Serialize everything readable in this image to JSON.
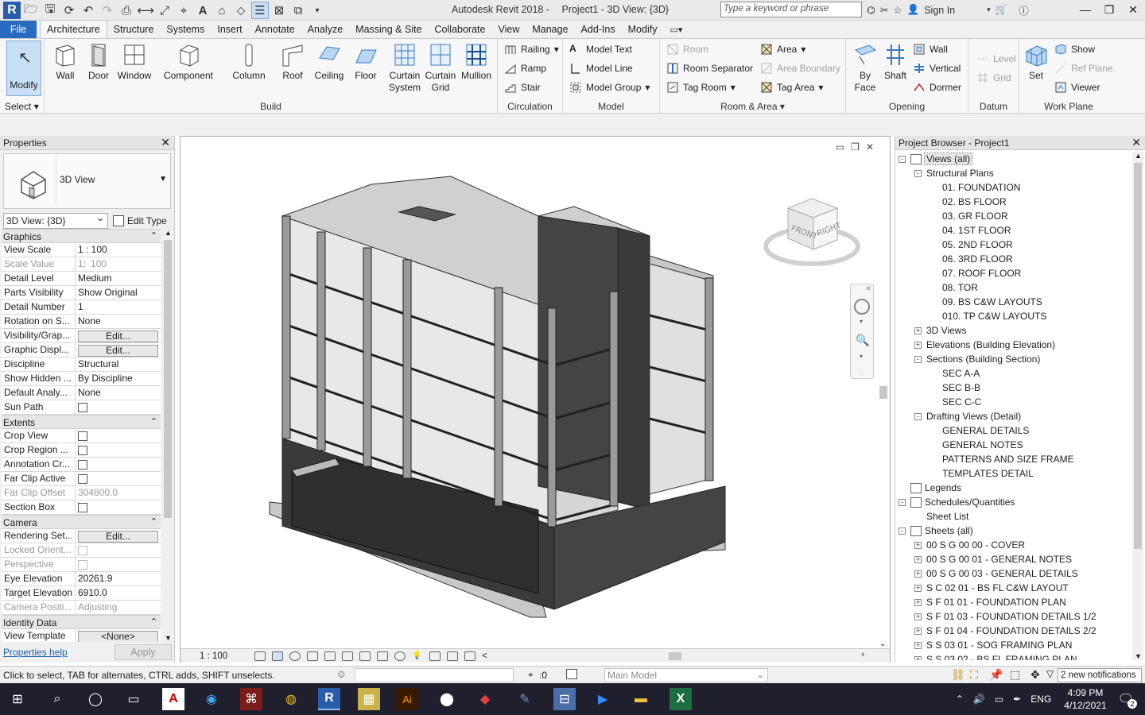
{
  "titlebar": {
    "app_title": "Autodesk Revit 2018 -",
    "doc_title": "Project1 - 3D View: {3D}",
    "search_placeholder": "Type a keyword or phrase",
    "sign_in": "Sign In"
  },
  "tabs": [
    "File",
    "Architecture",
    "Structure",
    "Systems",
    "Insert",
    "Annotate",
    "Analyze",
    "Massing & Site",
    "Collaborate",
    "View",
    "Manage",
    "Add-Ins",
    "Modify"
  ],
  "ribbon": {
    "select": {
      "modify": "Modify",
      "title": "Select"
    },
    "build": {
      "title": "Build",
      "wall": "Wall",
      "door": "Door",
      "window": "Window",
      "component": "Component",
      "column": "Column",
      "roof": "Roof",
      "ceiling": "Ceiling",
      "floor": "Floor",
      "curtain_system_1": "Curtain",
      "curtain_system_2": "System",
      "curtain_grid_1": "Curtain",
      "curtain_grid_2": "Grid",
      "mullion": "Mullion"
    },
    "circulation": {
      "title": "Circulation",
      "railing": "Railing",
      "ramp": "Ramp",
      "stair": "Stair"
    },
    "model": {
      "title": "Model",
      "model_text": "Model  Text",
      "model_line": "Model  Line",
      "model_group": "Model  Group"
    },
    "room_area": {
      "title": "Room & Area",
      "room": "Room",
      "room_separator": "Room  Separator",
      "tag_room": "Tag  Room",
      "area": "Area",
      "area_boundary": "Area  Boundary",
      "tag_area": "Tag  Area"
    },
    "opening": {
      "title": "Opening",
      "by_face_1": "By",
      "by_face_2": "Face",
      "shaft": "Shaft",
      "wall": "Wall",
      "vertical": "Vertical",
      "dormer": "Dormer"
    },
    "datum": {
      "title": "Datum",
      "level": "Level",
      "grid": "Grid"
    },
    "work_plane": {
      "title": "Work Plane",
      "set": "Set",
      "show": "Show",
      "ref_plane": "Ref  Plane",
      "viewer": "Viewer"
    }
  },
  "properties": {
    "title": "Properties",
    "type_name": "3D View",
    "view_selector": "3D View: {3D}",
    "edit_type": "Edit Type",
    "groups": [
      {
        "name": "Graphics",
        "rows": [
          {
            "label": "View Scale",
            "value": "1 : 100"
          },
          {
            "label": "Scale Value",
            "value": "100",
            "prefix": "1:",
            "disabled": true
          },
          {
            "label": "Detail Level",
            "value": "Medium"
          },
          {
            "label": "Parts Visibility",
            "value": "Show Original"
          },
          {
            "label": "Detail Number",
            "value": "1"
          },
          {
            "label": "Rotation on S...",
            "value": "None"
          },
          {
            "label": "Visibility/Grap...",
            "value": "Edit...",
            "button": true
          },
          {
            "label": "Graphic Displ...",
            "value": "Edit...",
            "button": true
          },
          {
            "label": "Discipline",
            "value": "Structural"
          },
          {
            "label": "Show Hidden ...",
            "value": "By Discipline"
          },
          {
            "label": "Default Analy...",
            "value": "None"
          },
          {
            "label": "Sun Path",
            "value": "",
            "checkbox": true
          }
        ]
      },
      {
        "name": "Extents",
        "rows": [
          {
            "label": "Crop View",
            "value": "",
            "checkbox": true
          },
          {
            "label": "Crop Region ...",
            "value": "",
            "checkbox": true
          },
          {
            "label": "Annotation Cr...",
            "value": "",
            "checkbox": true
          },
          {
            "label": "Far Clip Active",
            "value": "",
            "checkbox": true
          },
          {
            "label": "Far Clip Offset",
            "value": "304800.0",
            "disabled": true
          },
          {
            "label": "Section Box",
            "value": "",
            "checkbox": true
          }
        ]
      },
      {
        "name": "Camera",
        "rows": [
          {
            "label": "Rendering Set...",
            "value": "Edit...",
            "button": true
          },
          {
            "label": "Locked Orient...",
            "value": "",
            "checkbox": true,
            "disabled": true
          },
          {
            "label": "Perspective",
            "value": "",
            "checkbox": true,
            "disabled": true
          },
          {
            "label": "Eye Elevation",
            "value": "20261.9"
          },
          {
            "label": "Target Elevation",
            "value": "6910.0"
          },
          {
            "label": "Camera Positi...",
            "value": "Adjusting",
            "disabled": true
          }
        ]
      },
      {
        "name": "Identity Data",
        "rows": [
          {
            "label": "View Template",
            "value": "<None>",
            "button": true
          }
        ]
      }
    ],
    "help": "Properties help",
    "apply": "Apply"
  },
  "view": {
    "scale": "1 : 100",
    "cube_front": "FRONT",
    "cube_right": "RIGHT"
  },
  "browser": {
    "title": "Project Browser - Project1",
    "nodes": [
      {
        "label": "Views (all)",
        "level": 0,
        "toggle": "-",
        "icon": true,
        "selected": true
      },
      {
        "label": "Structural Plans",
        "level": 1,
        "toggle": "-"
      },
      {
        "label": "01. FOUNDATION",
        "level": 2
      },
      {
        "label": "02. BS FLOOR",
        "level": 2
      },
      {
        "label": "03. GR FLOOR",
        "level": 2
      },
      {
        "label": "04. 1ST FLOOR",
        "level": 2
      },
      {
        "label": "05. 2ND FLOOR",
        "level": 2
      },
      {
        "label": "06. 3RD FLOOR",
        "level": 2
      },
      {
        "label": "07. ROOF FLOOR",
        "level": 2
      },
      {
        "label": "08. TOR",
        "level": 2
      },
      {
        "label": "09. BS C&W LAYOUTS",
        "level": 2
      },
      {
        "label": "010. TP C&W LAYOUTS",
        "level": 2
      },
      {
        "label": "3D Views",
        "level": 1,
        "toggle": "+"
      },
      {
        "label": "Elevations (Building Elevation)",
        "level": 1,
        "toggle": "+"
      },
      {
        "label": "Sections (Building Section)",
        "level": 1,
        "toggle": "-"
      },
      {
        "label": "SEC A-A",
        "level": 2
      },
      {
        "label": "SEC B-B",
        "level": 2
      },
      {
        "label": "SEC C-C",
        "level": 2
      },
      {
        "label": "Drafting Views (Detail)",
        "level": 1,
        "toggle": "-"
      },
      {
        "label": "GENERAL DETAILS",
        "level": 2
      },
      {
        "label": "GENERAL NOTES",
        "level": 2
      },
      {
        "label": "PATTERNS AND SIZE FRAME",
        "level": 2
      },
      {
        "label": "TEMPLATES DETAIL",
        "level": 2
      },
      {
        "label": "Legends",
        "level": 0,
        "toggle": "",
        "icon": true
      },
      {
        "label": "Schedules/Quantities",
        "level": 0,
        "toggle": "-",
        "icon": true
      },
      {
        "label": "Sheet List",
        "level": 1
      },
      {
        "label": "Sheets (all)",
        "level": 0,
        "toggle": "-",
        "icon": true
      },
      {
        "label": "00 S G 00 00 - COVER",
        "level": 1,
        "toggle": "+"
      },
      {
        "label": "00 S G 00 01 - GENERAL NOTES",
        "level": 1,
        "toggle": "+"
      },
      {
        "label": "00 S G 00 03 - GENERAL DETAILS",
        "level": 1,
        "toggle": "+"
      },
      {
        "label": "S C 02 01 - BS FL C&W LAYOUT",
        "level": 1,
        "toggle": "+"
      },
      {
        "label": "S F 01 01 - FOUNDATION PLAN",
        "level": 1,
        "toggle": "+"
      },
      {
        "label": "S F 01 03 - FOUNDATION DETAILS 1/2",
        "level": 1,
        "toggle": "+"
      },
      {
        "label": "S F 01 04 - FOUNDATION DETAILS 2/2",
        "level": 1,
        "toggle": "+"
      },
      {
        "label": "S S 03 01 - SOG FRAMING PLAN",
        "level": 1,
        "toggle": "+"
      },
      {
        "label": "S S 03 02 - BS FL FRAMING PLAN",
        "level": 1,
        "toggle": "+"
      }
    ]
  },
  "status": {
    "hint": "Click to select, TAB for alternates, CTRL adds, SHIFT unselects.",
    "zero": ":0",
    "model": "Main Model",
    "notifications": "2 new notifications"
  },
  "taskbar": {
    "lang": "ENG",
    "time": "4:09 PM",
    "date": "4/12/2021",
    "notif_count": "2"
  }
}
